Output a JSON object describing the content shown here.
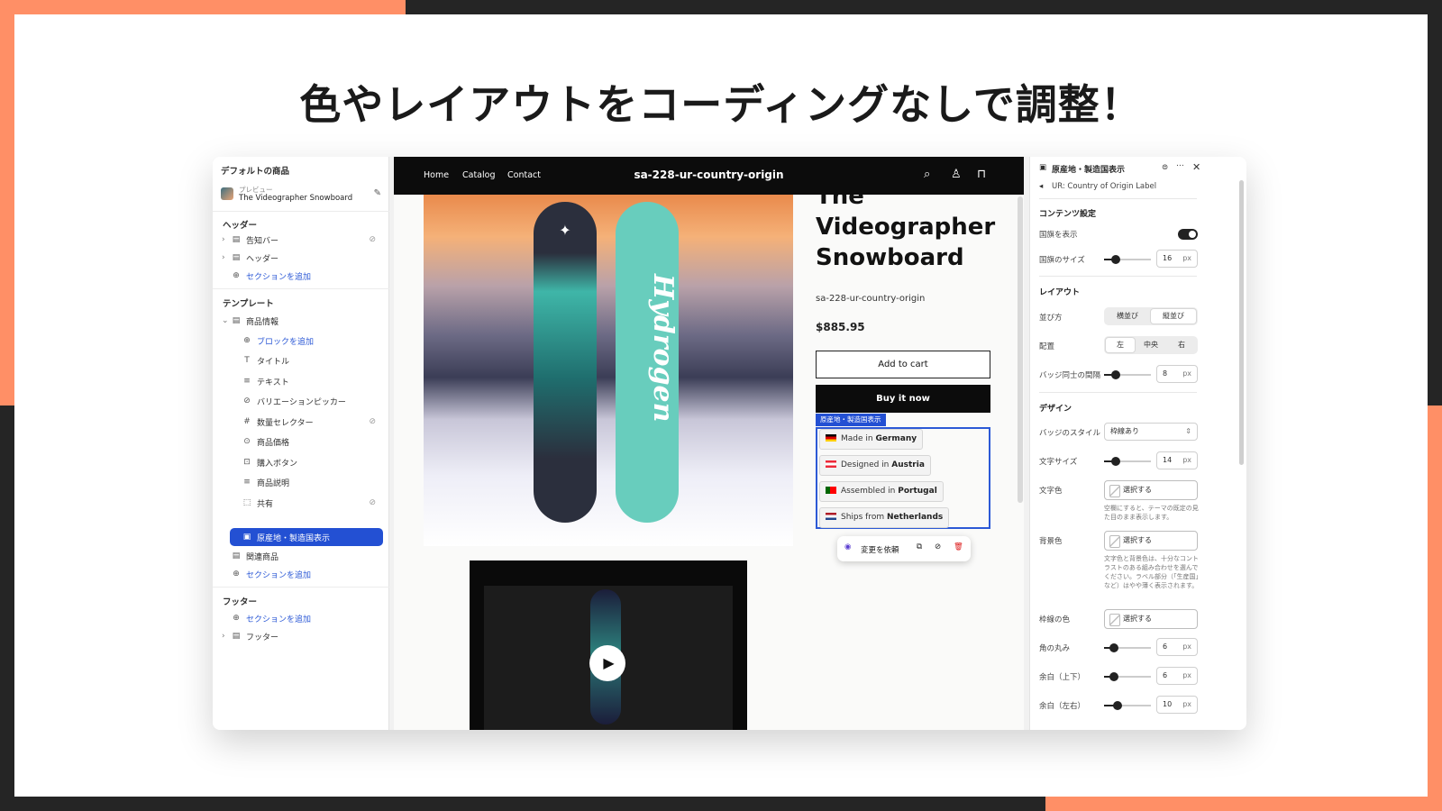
{
  "headline": "色やレイアウトをコーディングなしで調整！",
  "left": {
    "title": "デフォルトの商品",
    "preview_label": "プレビュー",
    "preview_name": "The Videographer Snowboard",
    "header_section": "ヘッダー",
    "header_items": [
      "告知バー",
      "ヘッダー"
    ],
    "add_section": "セクションを追加",
    "template_section": "テンプレート",
    "product_info": "商品情報",
    "add_block": "ブロックを追加",
    "blocks": [
      "タイトル",
      "テキスト",
      "バリエーションピッカー",
      "数量セレクター",
      "商品価格",
      "購入ボタン",
      "商品説明",
      "共有"
    ],
    "selected_block": "原産地・製造国表示",
    "related": "関連商品",
    "footer_section": "フッター",
    "footer_item": "フッター"
  },
  "store": {
    "nav": [
      "Home",
      "Catalog",
      "Contact"
    ],
    "name": "sa-228-ur-country-origin",
    "product_title": "The Videographer Snowboard",
    "vendor": "sa-228-ur-country-origin",
    "price": "$885.95",
    "add_to_cart": "Add to cart",
    "buy_now": "Buy it now",
    "block_tag": "原産地・製造国表示",
    "board_word": "Hydrogen",
    "badges": [
      {
        "prefix": "Made in",
        "country": "Germany",
        "flag": [
          "#000000",
          "#dd0000",
          "#ffce00"
        ]
      },
      {
        "prefix": "Designed in",
        "country": "Austria",
        "flag": [
          "#ed2939",
          "#ffffff",
          "#ed2939"
        ]
      },
      {
        "prefix": "Assembled in",
        "country": "Portugal",
        "flag": [
          "#006600",
          "#ff0000",
          "#ff0000"
        ]
      },
      {
        "prefix": "Ships from",
        "country": "Netherlands",
        "flag": [
          "#ae1c28",
          "#ffffff",
          "#21468b"
        ]
      }
    ],
    "request_change": "変更を依頼"
  },
  "right": {
    "title": "原産地・製造国表示",
    "app_name": "UR: Country of Origin Label",
    "content_section": "コンテンツ設定",
    "show_flag": "国旗を表示",
    "flag_size": "国旗のサイズ",
    "flag_size_value": "16",
    "layout_section": "レイアウト",
    "arrangement": "並び方",
    "arrangement_options": [
      "横並び",
      "縦並び"
    ],
    "alignment": "配置",
    "alignment_options": [
      "左",
      "中央",
      "右"
    ],
    "badge_gap": "バッジ同士の間隔",
    "badge_gap_value": "8",
    "design_section": "デザイン",
    "badge_style": "バッジのスタイル",
    "badge_style_value": "枠線あり",
    "font_size": "文字サイズ",
    "font_size_value": "14",
    "text_color": "文字色",
    "select": "選択する",
    "text_color_hint": "空欄にすると、テーマの既定の見た目のまま表示します。",
    "bg_color": "背景色",
    "bg_color_hint": "文字色と背景色は、十分なコントラストのある組み合わせを選んでください。ラベル部分（「生産国」など）はやや薄く表示されます。",
    "border_color": "枠線の色",
    "radius": "角の丸み",
    "radius_value": "6",
    "pad_v": "余白（上下）",
    "pad_v_value": "6",
    "pad_h": "余白（左右）",
    "pad_h_value": "10",
    "unit": "px"
  }
}
